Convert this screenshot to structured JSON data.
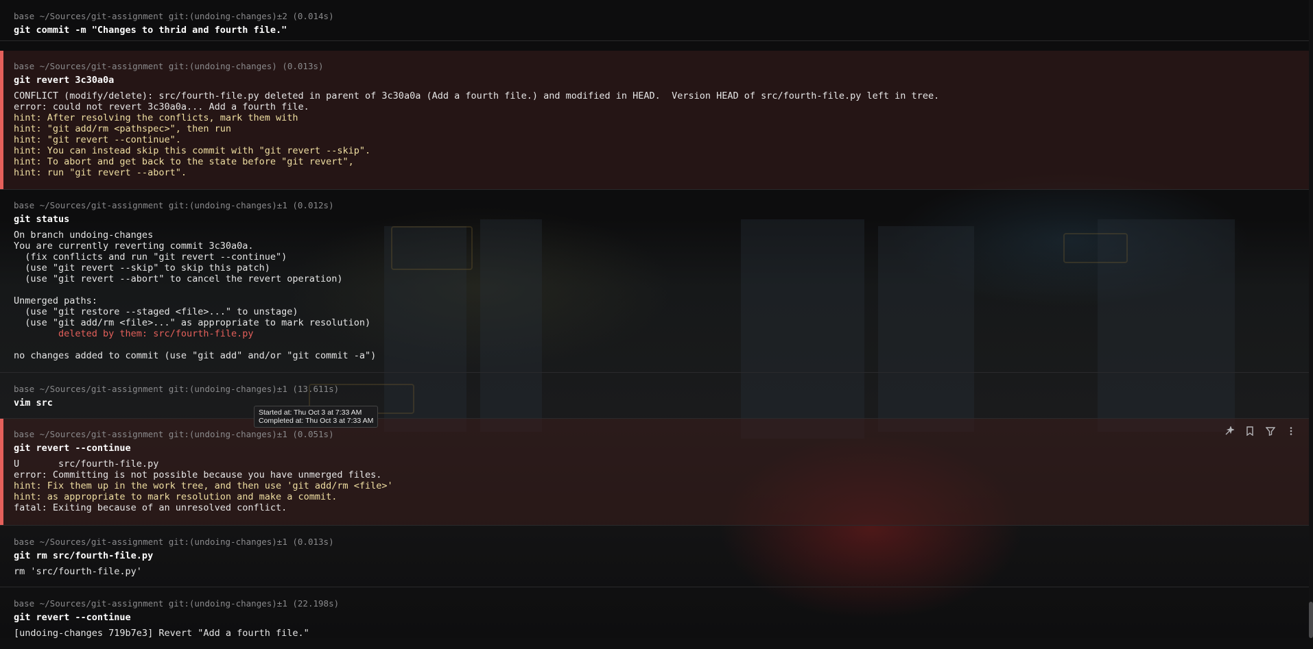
{
  "blocks": [
    {
      "prompt": "base ~/Sources/git-assignment git:(undoing-changes)±2 (0.014s)",
      "command": "git commit -m \"Changes to thrid and fourth file.\"",
      "error": false,
      "output": []
    },
    {
      "prompt": "base ~/Sources/git-assignment git:(undoing-changes) (0.013s)",
      "command": "git revert 3c30a0a",
      "error": true,
      "output": [
        {
          "text": "CONFLICT (modify/delete): src/fourth-file.py deleted in parent of 3c30a0a (Add a fourth file.) and modified in HEAD.  Version HEAD of src/fourth-file.py left in tree.",
          "style": "normal"
        },
        {
          "text": "error: could not revert 3c30a0a... Add a fourth file.",
          "style": "normal"
        },
        {
          "text": "hint: After resolving the conflicts, mark them with",
          "style": "hint"
        },
        {
          "text": "hint: \"git add/rm <pathspec>\", then run",
          "style": "hint"
        },
        {
          "text": "hint: \"git revert --continue\".",
          "style": "hint"
        },
        {
          "text": "hint: You can instead skip this commit with \"git revert --skip\".",
          "style": "hint"
        },
        {
          "text": "hint: To abort and get back to the state before \"git revert\",",
          "style": "hint"
        },
        {
          "text": "hint: run \"git revert --abort\".",
          "style": "hint"
        }
      ]
    },
    {
      "prompt": "base ~/Sources/git-assignment git:(undoing-changes)±1 (0.012s)",
      "command": "git status",
      "error": false,
      "output": [
        {
          "text": "On branch undoing-changes",
          "style": "normal"
        },
        {
          "text": "You are currently reverting commit 3c30a0a.",
          "style": "normal"
        },
        {
          "text": "  (fix conflicts and run \"git revert --continue\")",
          "style": "normal"
        },
        {
          "text": "  (use \"git revert --skip\" to skip this patch)",
          "style": "normal"
        },
        {
          "text": "  (use \"git revert --abort\" to cancel the revert operation)",
          "style": "normal"
        },
        {
          "text": "",
          "style": "normal"
        },
        {
          "text": "Unmerged paths:",
          "style": "normal"
        },
        {
          "text": "  (use \"git restore --staged <file>...\" to unstage)",
          "style": "normal"
        },
        {
          "text": "  (use \"git add/rm <file>...\" as appropriate to mark resolution)",
          "style": "normal"
        },
        {
          "text": "        deleted by them: src/fourth-file.py",
          "style": "red"
        },
        {
          "text": "",
          "style": "normal"
        },
        {
          "text": "no changes added to commit (use \"git add\" and/or \"git commit -a\")",
          "style": "normal"
        }
      ]
    },
    {
      "prompt": "base ~/Sources/git-assignment git:(undoing-changes)±1 (13.611s)",
      "command": "vim src",
      "error": false,
      "output": []
    },
    {
      "prompt": "base ~/Sources/git-assignment git:(undoing-changes)±1 (0.051s)",
      "command": "git revert --continue",
      "error": true,
      "output": [
        {
          "text": "U       src/fourth-file.py",
          "style": "normal"
        },
        {
          "text": "error: Committing is not possible because you have unmerged files.",
          "style": "normal"
        },
        {
          "text": "hint: Fix them up in the work tree, and then use 'git add/rm <file>'",
          "style": "hint"
        },
        {
          "text": "hint: as appropriate to mark resolution and make a commit.",
          "style": "hint"
        },
        {
          "text": "fatal: Exiting because of an unresolved conflict.",
          "style": "normal"
        }
      ]
    },
    {
      "prompt": "base ~/Sources/git-assignment git:(undoing-changes)±1 (0.013s)",
      "command": "git rm src/fourth-file.py",
      "error": false,
      "output": [
        {
          "text": "rm 'src/fourth-file.py'",
          "style": "normal"
        }
      ]
    },
    {
      "prompt": "base ~/Sources/git-assignment git:(undoing-changes)±1 (22.198s)",
      "command": "git revert --continue",
      "error": false,
      "output": [
        {
          "text": "[undoing-changes 719b7e3] Revert \"Add a fourth file.\"",
          "style": "normal"
        }
      ]
    }
  ],
  "tooltip": {
    "started": "Started at: Thu Oct 3 at 7:33 AM",
    "completed": "Completed at: Thu Oct 3 at 7:33 AM"
  },
  "toolbar_icons": [
    "ai-sparkle-icon",
    "bookmark-icon",
    "filter-icon",
    "more-vertical-icon"
  ],
  "colors": {
    "background": "#0f0f10",
    "error_accent": "#e5605b",
    "hint_text": "#f0dfa2",
    "prompt_text": "#8a8a8c"
  }
}
